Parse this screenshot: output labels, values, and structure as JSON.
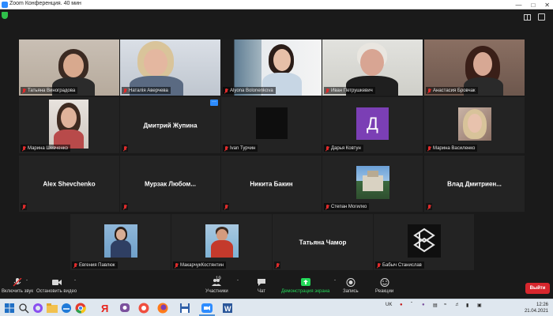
{
  "window": {
    "title": "Zoom Конференция. 40 мин"
  },
  "participants": [
    {
      "name": "Татьяна Виноградова",
      "muted": true
    },
    {
      "name": "Наталія Аверчева",
      "muted": true
    },
    {
      "name": "Alyona Bolonenkova",
      "muted": true
    },
    {
      "name": "Иван Петрушкевич",
      "muted": true
    },
    {
      "name": "Анастасия Бровчак",
      "muted": true
    },
    {
      "name": "Марина Шевченко",
      "muted": true
    },
    {
      "name": "Дмитрий Жупина",
      "muted": true
    },
    {
      "name": "Ivan Турчин",
      "muted": true
    },
    {
      "name": "Дарья Ковтун",
      "muted": true,
      "avatar_letter": "Д"
    },
    {
      "name": "Марина Василенко",
      "muted": true
    },
    {
      "name": "Alex Shevchenko",
      "muted": true
    },
    {
      "name": "Мурзак  Любом...",
      "muted": true
    },
    {
      "name": "Никита Бакин",
      "muted": true
    },
    {
      "name": "Степан Могилко",
      "muted": true
    },
    {
      "name": "Влад  Дмитриен...",
      "muted": true
    },
    {
      "name": "Евгения Павлюк",
      "muted": true
    },
    {
      "name": "МакарчукКостянтин",
      "muted": true
    },
    {
      "name": "Татьяна Чамор",
      "muted": true
    },
    {
      "name": "Бабыч Станислав",
      "muted": true
    }
  ],
  "tile_more_button": "···",
  "toolbar": {
    "unmute_label": "Включить звук",
    "stop_video_label": "Остановить видео",
    "participants_label": "Участники",
    "participants_count": "19",
    "chat_label": "Чат",
    "share_label": "Демонстрация экрана",
    "record_label": "Запись",
    "reactions_label": "Реакции",
    "end_label": "Выйти"
  },
  "taskbar": {
    "tray_language": "UK",
    "time": "12:26",
    "date": "21.04.2021"
  },
  "colors": {
    "background": "#1a1a1a",
    "tile": "#232323",
    "active_speaker": "#e6f03c",
    "muted_red": "#e02b2b",
    "share_green": "#23d959",
    "end_red": "#d7262d",
    "avatar_purple": "#7b3fb5",
    "zoom_blue": "#2d8cff"
  },
  "icons": {
    "taskbar": [
      "windows-icon",
      "search-icon",
      "alice-icon",
      "file-explorer-icon",
      "edge-icon",
      "chrome-icon",
      "yandex-icon",
      "viber-icon",
      "yandex-browser-icon",
      "firefox-icon",
      "save-icon",
      "zoom-icon",
      "word-icon"
    ]
  }
}
